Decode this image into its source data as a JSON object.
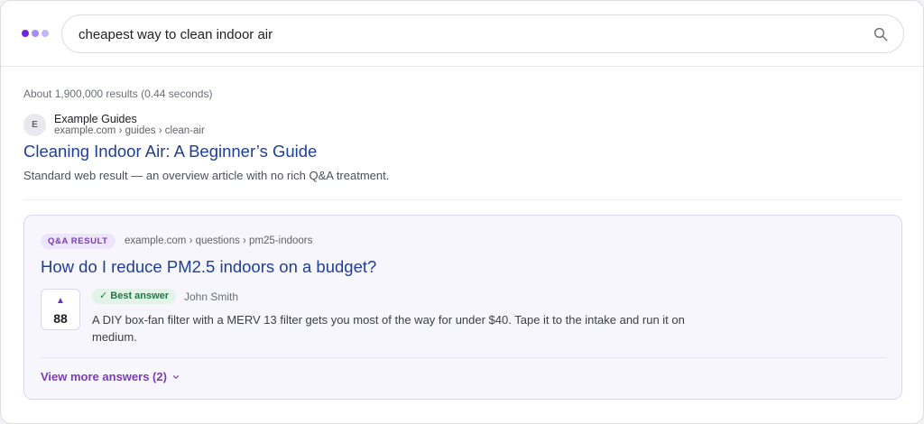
{
  "header": {
    "logo_icon": "three-dots-logo",
    "logo_colors": [
      "#6d28d9",
      "#a78bfa",
      "#c4b5fd"
    ],
    "search_query": "cheapest way to clean indoor air",
    "search_icon": "search-icon"
  },
  "results_stats": "About 1,900,000 results (0.44 seconds)",
  "result1": {
    "avatar_letter": "E",
    "site_name": "Example Guides",
    "url": "example.com › guides › clean-air",
    "title": "Cleaning Indoor Air: A Beginner’s Guide",
    "description": "Standard web result — an overview article with no rich Q&A treatment."
  },
  "qa_result": {
    "badge": "Q&A RESULT",
    "url": "example.com › questions › pm25-indoors",
    "title": "How do I reduce PM2.5 indoors on a budget?",
    "upvote_icon": "▲",
    "votes": "88",
    "best_answer_label": "✓ Best answer",
    "author": "John Smith",
    "answer_text": "A DIY box-fan filter with a MERV 13 filter gets you most of the way for under $40. Tape it to the intake and run it on medium.",
    "view_more_label": "View more answers (2)",
    "view_more_icon": "chevron-down-icon"
  },
  "colors": {
    "link": "#1f3f96",
    "accent_purple": "#7b3bb7",
    "best_answer_green": "#1e7a43",
    "qa_card_bg": "#f8f6fd"
  }
}
